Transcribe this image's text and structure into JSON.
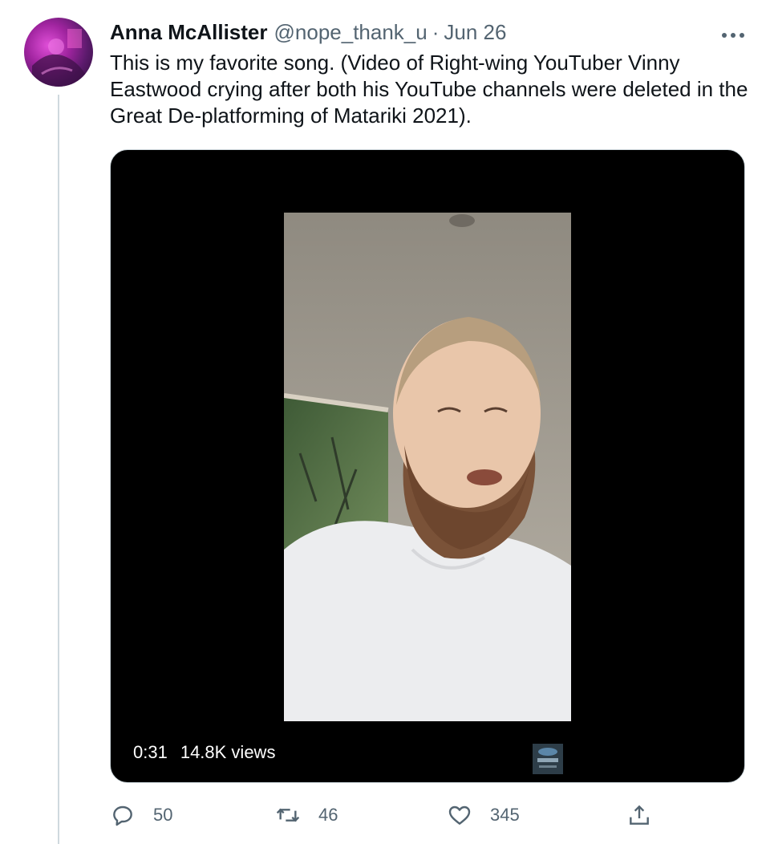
{
  "tweet": {
    "display_name": "Anna McAllister",
    "handle": "@nope_thank_u",
    "separator": "·",
    "date": "Jun 26",
    "text": "This is my favorite song. (Video of Right-wing YouTuber Vinny Eastwood crying after both his YouTube channels were deleted in the Great De-platforming of Matariki 2021).",
    "more_icon": "more-horizontal-icon"
  },
  "media": {
    "duration": "0:31",
    "views": "14.8K views"
  },
  "actions": {
    "reply": {
      "icon": "reply-icon",
      "count": "50"
    },
    "retweet": {
      "icon": "retweet-icon",
      "count": "46"
    },
    "like": {
      "icon": "heart-icon",
      "count": "345"
    },
    "share": {
      "icon": "share-icon"
    }
  },
  "colors": {
    "text_primary": "#0f1419",
    "text_secondary": "#536471",
    "border": "#cfd9de",
    "media_background": "#000000"
  }
}
